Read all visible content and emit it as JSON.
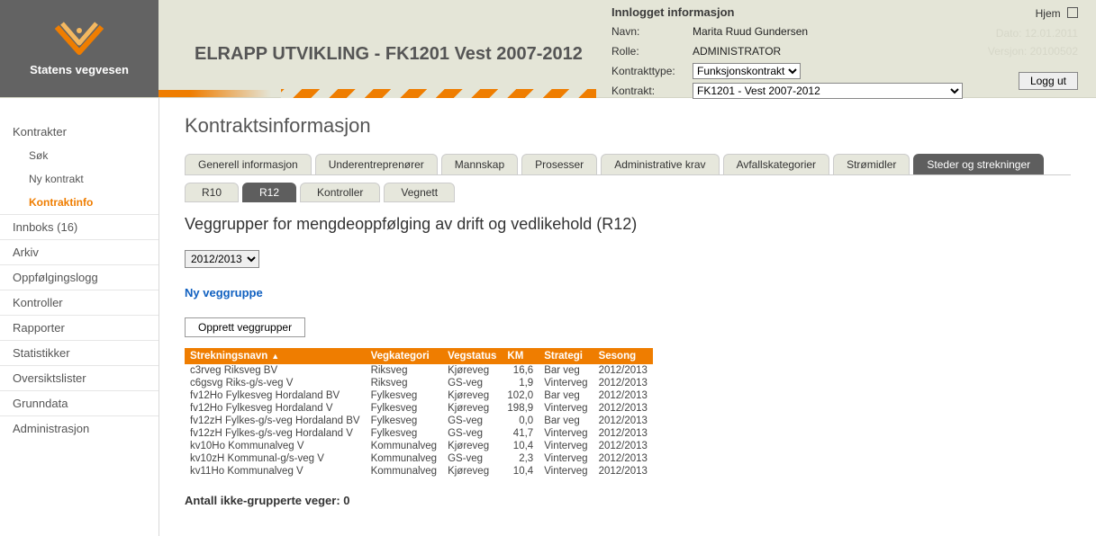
{
  "org_name": "Statens vegvesen",
  "app_title": "ELRAPP UTVIKLING - FK1201 Vest 2007-2012",
  "info": {
    "title": "Innlogget informasjon",
    "hjem_label": "Hjem",
    "labels": {
      "navn": "Navn:",
      "rolle": "Rolle:",
      "kontrakttype": "Kontrakttype:",
      "kontrakt": "Kontrakt:",
      "dato": "Dato:",
      "versjon": "Versjon:"
    },
    "navn": "Marita Ruud Gundersen",
    "rolle": "ADMINISTRATOR",
    "kontrakttype_selected": "Funksjonskontrakt",
    "kontrakt_selected": "FK1201 - Vest 2007-2012",
    "dato": "12.01.2011",
    "versjon": "20100502",
    "logout": "Logg ut"
  },
  "sidebar": {
    "kontrakter": "Kontrakter",
    "sok": "Søk",
    "nykontrakt": "Ny kontrakt",
    "kontraktinfo": "Kontraktinfo",
    "innboks": "Innboks (16)",
    "arkiv": "Arkiv",
    "oppfolg": "Oppfølgingslogg",
    "kontroller": "Kontroller",
    "rapporter": "Rapporter",
    "statistikker": "Statistikker",
    "oversikt": "Oversiktslister",
    "grunndata": "Grunndata",
    "admin": "Administrasjon"
  },
  "page": {
    "h1": "Kontraktsinformasjon",
    "tabs": [
      "Generell informasjon",
      "Underentreprenører",
      "Mannskap",
      "Prosesser",
      "Administrative krav",
      "Avfallskategorier",
      "Strømidler",
      "Steder og strekninger"
    ],
    "active_tab_index": 7,
    "subtabs": [
      "R10",
      "R12",
      "Kontroller",
      "Vegnett"
    ],
    "active_subtab_index": 1,
    "h2": "Veggrupper for mengdeoppfølging av drift og vedlikehold (R12)",
    "year_selected": "2012/2013",
    "new_group_link": "Ny veggruppe",
    "create_button": "Opprett veggrupper",
    "table": {
      "headers": [
        "Strekningsnavn",
        "Vegkategori",
        "Vegstatus",
        "KM",
        "Strategi",
        "Sesong"
      ],
      "sort_col_index": 0,
      "rows": [
        {
          "name": "c3rveg Riksveg BV",
          "kat": "Riksveg",
          "stat": "Kjøreveg",
          "km": "16,6",
          "str": "Bar veg",
          "ses": "2012/2013"
        },
        {
          "name": "c6gsvg Riks-g/s-veg V",
          "kat": "Riksveg",
          "stat": "GS-veg",
          "km": "1,9",
          "str": "Vinterveg",
          "ses": "2012/2013"
        },
        {
          "name": "fv12Ho Fylkesveg Hordaland BV",
          "kat": "Fylkesveg",
          "stat": "Kjøreveg",
          "km": "102,0",
          "str": "Bar veg",
          "ses": "2012/2013"
        },
        {
          "name": "fv12Ho Fylkesveg Hordaland V",
          "kat": "Fylkesveg",
          "stat": "Kjøreveg",
          "km": "198,9",
          "str": "Vinterveg",
          "ses": "2012/2013"
        },
        {
          "name": "fv12zH Fylkes-g/s-veg Hordaland BV",
          "kat": "Fylkesveg",
          "stat": "GS-veg",
          "km": "0,0",
          "str": "Bar veg",
          "ses": "2012/2013"
        },
        {
          "name": "fv12zH Fylkes-g/s-veg Hordaland V",
          "kat": "Fylkesveg",
          "stat": "GS-veg",
          "km": "41,7",
          "str": "Vinterveg",
          "ses": "2012/2013"
        },
        {
          "name": "kv10Ho Kommunalveg V",
          "kat": "Kommunalveg",
          "stat": "Kjøreveg",
          "km": "10,4",
          "str": "Vinterveg",
          "ses": "2012/2013"
        },
        {
          "name": "kv10zH Kommunal-g/s-veg V",
          "kat": "Kommunalveg",
          "stat": "GS-veg",
          "km": "2,3",
          "str": "Vinterveg",
          "ses": "2012/2013"
        },
        {
          "name": "kv11Ho Kommunalveg V",
          "kat": "Kommunalveg",
          "stat": "Kjøreveg",
          "km": "10,4",
          "str": "Vinterveg",
          "ses": "2012/2013"
        }
      ]
    },
    "footer_label": "Antall ikke-grupperte veger:",
    "footer_value": "0"
  }
}
